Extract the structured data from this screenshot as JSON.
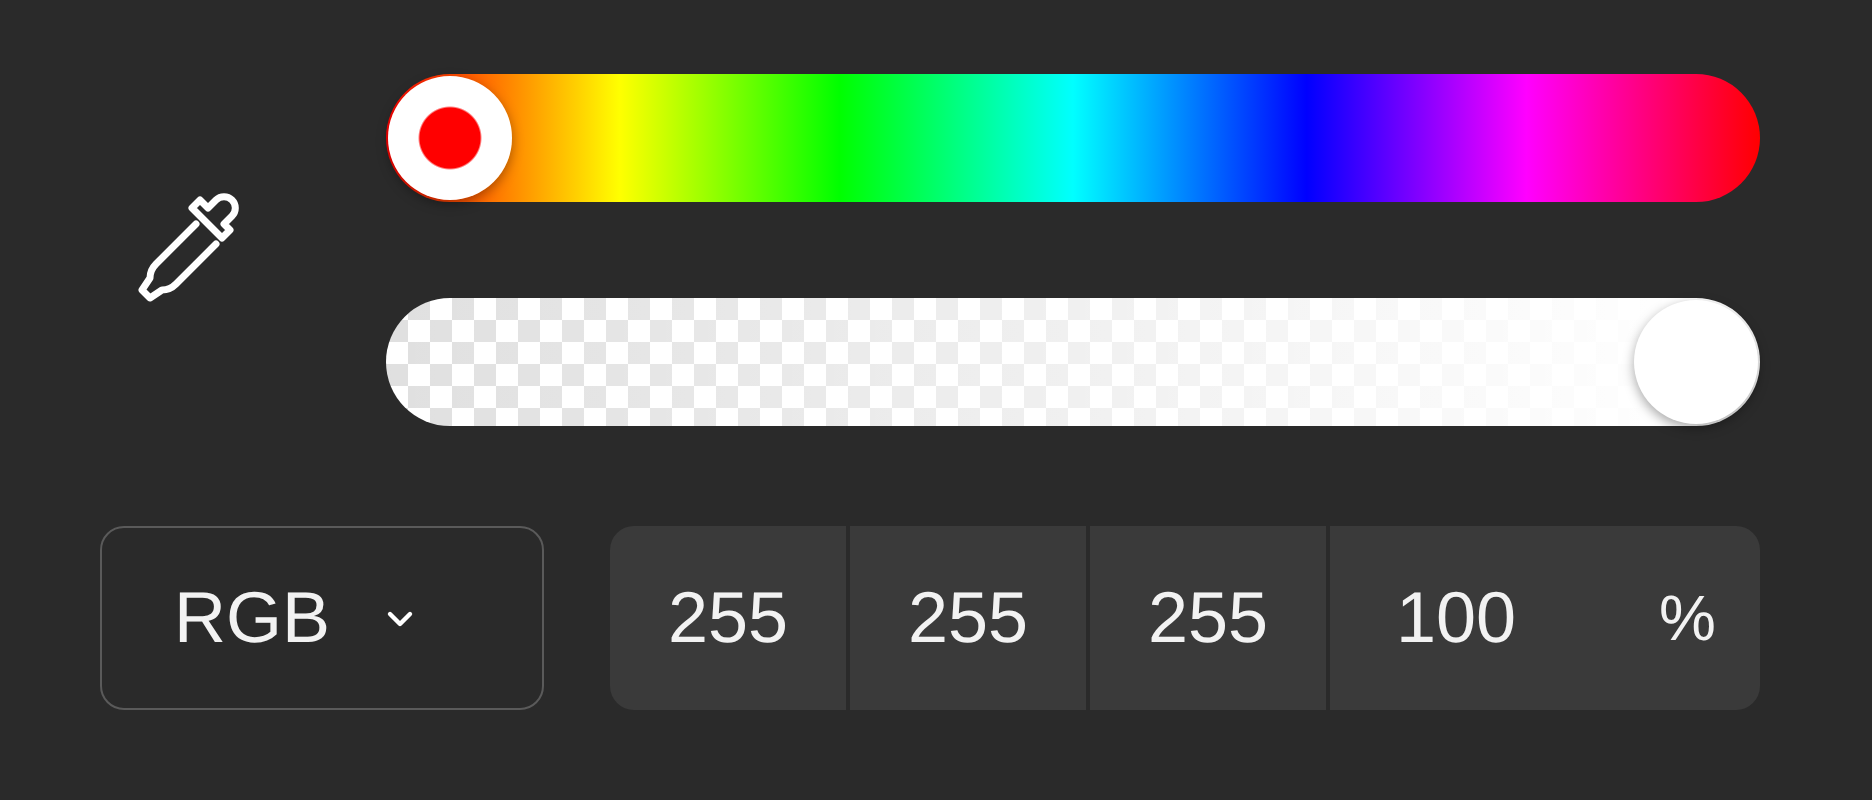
{
  "hue_slider": {
    "level": 0
  },
  "alpha_slider": {
    "level": 1
  },
  "mode_select": {
    "value": "RGB"
  },
  "values": [
    {
      "value": "255"
    },
    {
      "value": "255"
    },
    {
      "value": "255"
    },
    {
      "value": "100",
      "unit": "%"
    }
  ]
}
